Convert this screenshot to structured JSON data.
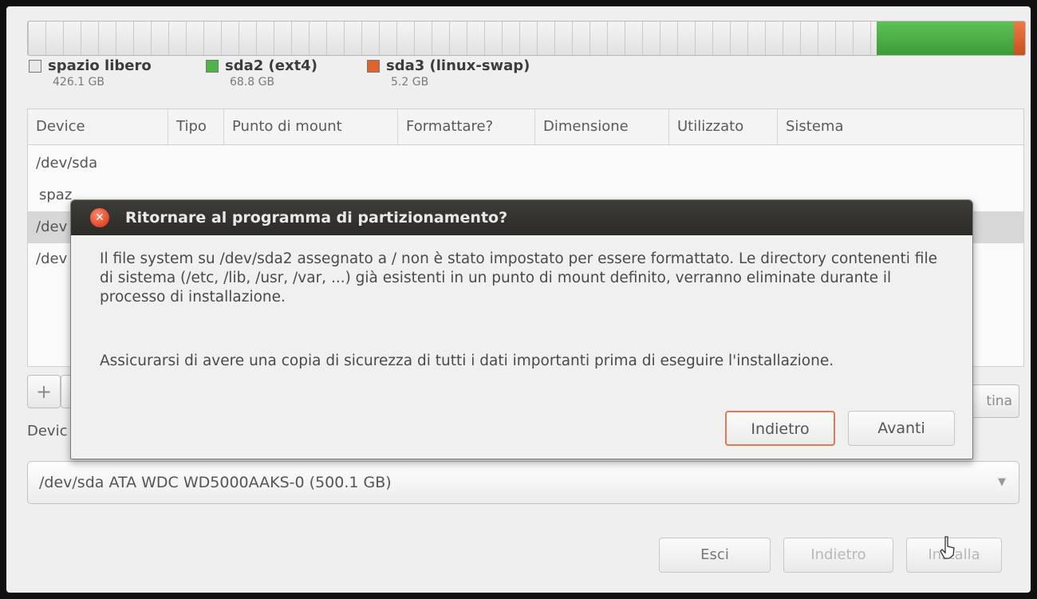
{
  "partition_bar": {
    "segments": [
      {
        "name": "spazio libero",
        "color": "#e4e4e4",
        "fraction": 0.8521
      },
      {
        "name": "sda2 (ext4)",
        "color": "#4fb34a",
        "fraction": 0.1375
      },
      {
        "name": "sda3 (linux-swap)",
        "color": "#e0622c",
        "fraction": 0.0104
      }
    ]
  },
  "legend": [
    {
      "name": "spazio libero",
      "size": "426.1 GB",
      "color": "#e8e8e8"
    },
    {
      "name": "sda2 (ext4)",
      "size": "68.8 GB",
      "color": "#4fb34a"
    },
    {
      "name": "sda3 (linux-swap)",
      "size": "5.2 GB",
      "color": "#e0622c"
    }
  ],
  "table": {
    "columns": [
      "Device",
      "Tipo",
      "Punto di mount",
      "Formattare?",
      "Dimensione",
      "Utilizzato",
      "Sistema"
    ],
    "rows": [
      "/dev/sda",
      "spaz",
      "/dev",
      "/dev"
    ]
  },
  "buttons": {
    "add": "+",
    "change": "tina",
    "quit": "Esci",
    "back": "Indietro",
    "install": "Installa"
  },
  "device_label": "Devic",
  "device_select": "/dev/sda   ATA WDC WD5000AAKS-0 (500.1 GB)",
  "dialog": {
    "title": "Ritornare al programma di partizionamento?",
    "paragraph1": "Il file system su /dev/sda2 assegnato a / non è stato impostato per essere formattato. Le directory contenenti file di sistema (/etc, /lib, /usr, /var, ...) già esistenti in un punto di mount definito, verranno eliminate durante il processo di installazione.",
    "paragraph2": "Assicurarsi di avere una copia di sicurezza di tutti i dati importanti prima di eseguire l'installazione.",
    "back_button": "Indietro",
    "continue_button": "Avanti"
  },
  "colors": {
    "accent": "#e0622c",
    "focus_border": "#e07a55",
    "titlebar": "#33312e"
  }
}
